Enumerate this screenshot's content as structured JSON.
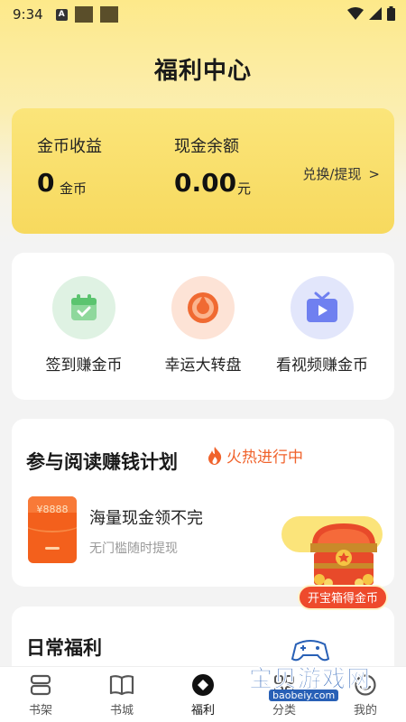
{
  "status_bar": {
    "time": "9:34",
    "notification_icon": "A"
  },
  "page_title": "福利中心",
  "earnings": {
    "coin_label": "金币收益",
    "coin_value": "0",
    "coin_unit": "金币",
    "cash_label": "现金余额",
    "cash_value": "0.00",
    "cash_unit": "元",
    "exchange_link": "兑换/提现",
    "exchange_chevron": ">"
  },
  "tasks": [
    {
      "label": "签到赚金币",
      "icon": "calendar-check-icon",
      "bg": "#dff2e3",
      "fg": "#5bc46f"
    },
    {
      "label": "幸运大转盘",
      "icon": "lucky-wheel-icon",
      "bg": "#fde3d6",
      "fg": "#f06a32"
    },
    {
      "label": "看视频赚金币",
      "icon": "tv-play-icon",
      "bg": "#e2e6fb",
      "fg": "#6f80f0"
    }
  ],
  "reading_plan": {
    "title": "参与阅读赚钱计划",
    "hot_label": "火热进行中",
    "envelope_amount": "¥8888",
    "main_text": "海量现金领不完",
    "sub_text": "无门槛随时提现"
  },
  "treasure_chest": {
    "button_label": "开宝箱得金币"
  },
  "daily": {
    "title": "日常福利"
  },
  "tabbar": [
    {
      "label": "书架",
      "icon": "bookshelf-icon"
    },
    {
      "label": "书城",
      "icon": "book-open-icon"
    },
    {
      "label": "福利",
      "icon": "welfare-icon"
    },
    {
      "label": "分类",
      "icon": "category-icon"
    },
    {
      "label": "我的",
      "icon": "profile-icon"
    }
  ],
  "watermark": {
    "text": "宝贝游戏网",
    "url": "baobeiy.com"
  },
  "colors": {
    "accent_gold": "#f7d95e",
    "hot_orange": "#f0622b",
    "envelope_orange": "#f3601c",
    "chest_red": "#ee4a2c"
  }
}
